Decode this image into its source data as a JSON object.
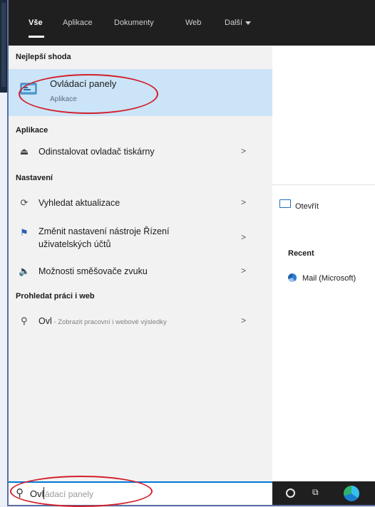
{
  "tabs": [
    {
      "label": "Vše",
      "active": true
    },
    {
      "label": "Aplikace",
      "active": false
    },
    {
      "label": "Dokumenty",
      "active": false
    },
    {
      "label": "Web",
      "active": false
    },
    {
      "label": "Další",
      "active": false,
      "dropdown": true
    }
  ],
  "best_match": {
    "section_title": "Nejlepší shoda",
    "title": "Ovládací panely",
    "subtitle": "Aplikace",
    "icon": "control-panel-icon"
  },
  "apps": {
    "section_title": "Aplikace",
    "items": [
      {
        "label": "Odinstalovat ovladač tiskárny",
        "icon": "uninstall-icon"
      }
    ]
  },
  "settings": {
    "section_title": "Nastavení",
    "items": [
      {
        "label": "Vyhledat aktualizace",
        "icon": "refresh-icon"
      },
      {
        "label_line1": "Změnit nastavení nástroje Řízení",
        "label_line2": "uživatelských účtů",
        "icon": "flag-icon"
      },
      {
        "label": "Možnosti směšovače zvuku",
        "icon": "speaker-icon"
      }
    ]
  },
  "web": {
    "section_title": "Prohledat práci i web",
    "query": "Ovl",
    "hint": " - Zobrazit pracovní i webové výsledky",
    "icon": "search-icon"
  },
  "preview": {
    "open_label": "Otevřít",
    "recent_title": "Recent",
    "recent_items": [
      {
        "label": "Mail (Microsoft)",
        "icon": "mail-icon"
      }
    ]
  },
  "search": {
    "typed": "Ovl",
    "ghost": "ádací panely"
  },
  "colors": {
    "accent": "#0078d7",
    "highlight": "#cce4f7",
    "annotation": "#d21f2b"
  }
}
